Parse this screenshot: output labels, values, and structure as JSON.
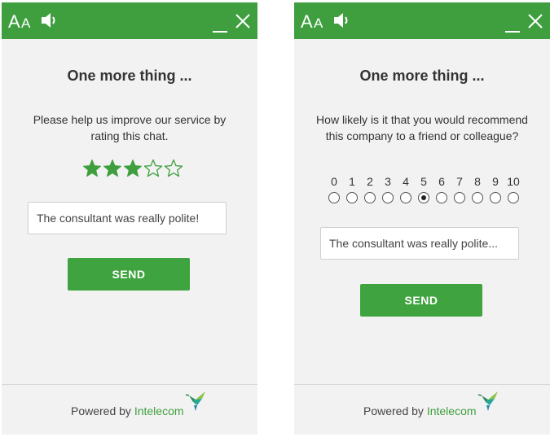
{
  "theme": {
    "accent": "#3f9f3f",
    "panel_bg": "#f2f2f2",
    "star_color": "#3f9f3f"
  },
  "left_panel": {
    "header": {
      "font_size_icon": "font-size-icon",
      "sound_icon": "speaker-icon",
      "minimize_icon": "minimize-icon",
      "close_icon": "close-icon"
    },
    "title": "One more thing ...",
    "question": "Please help us improve our service by rating this chat.",
    "rating": {
      "max": 5,
      "value": 3
    },
    "comment_value": "The consultant was really polite!",
    "send_label": "SEND",
    "footer": {
      "powered_by": "Powered by",
      "brand": "Intelecom"
    }
  },
  "right_panel": {
    "header": {
      "font_size_icon": "font-size-icon",
      "sound_icon": "speaker-icon",
      "minimize_icon": "minimize-icon",
      "close_icon": "close-icon"
    },
    "title": "One more thing ...",
    "question": "How likely is it that you would recommend this company to a friend or colleague?",
    "scale": {
      "labels": [
        "0",
        "1",
        "2",
        "3",
        "4",
        "5",
        "6",
        "7",
        "8",
        "9",
        "10"
      ],
      "selected": 5
    },
    "comment_value": "The consultant was really polite...",
    "send_label": "SEND",
    "footer": {
      "powered_by": "Powered by",
      "brand": "Intelecom"
    }
  }
}
